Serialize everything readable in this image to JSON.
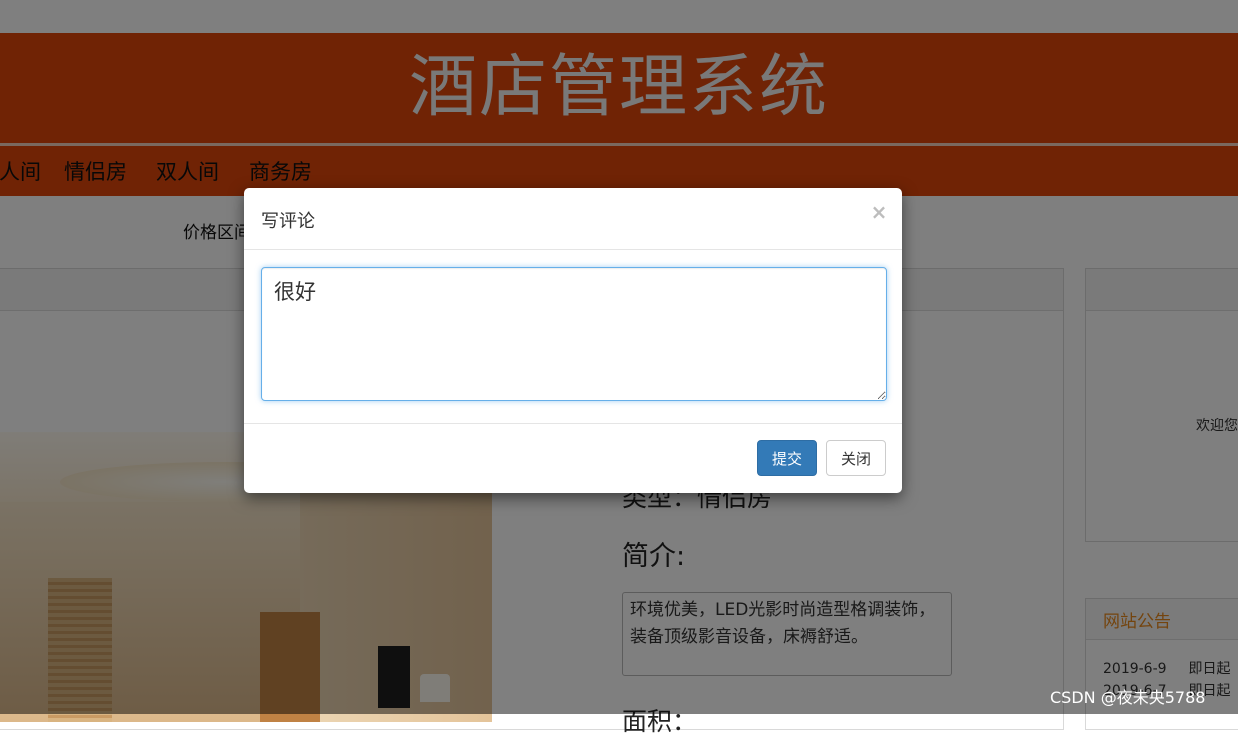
{
  "page": {
    "site_title": "酒店管理系统",
    "nav_items": [
      "单人间",
      "情侣房",
      "双人间",
      "商务房"
    ],
    "price_label": "价格区间",
    "room_type_label": "类型：情侣房",
    "intro_label": "简介:",
    "intro_text": "环境优美，LED光影时尚造型格调装饰，装备顶级影音设备，床褥舒适。",
    "area_label": "面积：",
    "welcome_text": "欢迎您",
    "notice": {
      "title": "网站公告",
      "items": [
        {
          "date": "2019-6-9",
          "text": "即日起"
        },
        {
          "date": "2019-6-7",
          "text": "即日起"
        }
      ]
    }
  },
  "modal": {
    "title": "写评论",
    "close_symbol": "×",
    "comment_value": "很好",
    "submit_label": "提交",
    "close_label": "关闭"
  },
  "watermark": "CSDN @夜未央5788",
  "colors": {
    "header": "#e0470b",
    "primary_button": "#337ab7",
    "notice_title": "#e8891d",
    "focus_border": "#66afe9"
  }
}
